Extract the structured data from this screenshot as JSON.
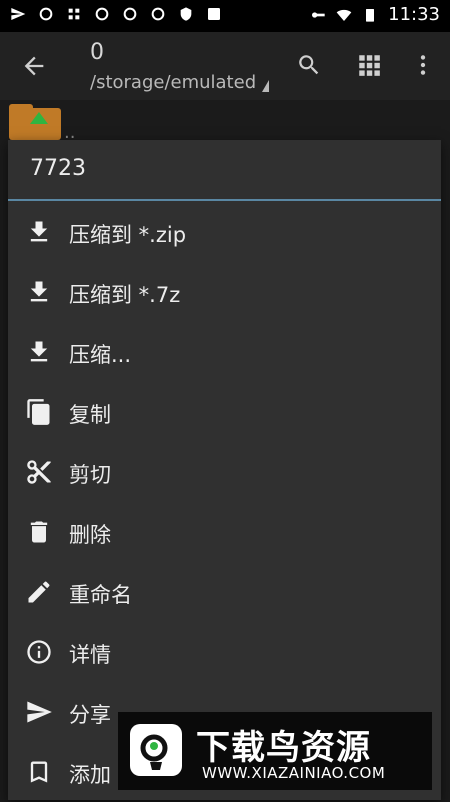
{
  "status_bar": {
    "time": "11:33"
  },
  "toolbar": {
    "title": "0",
    "path": "/storage/emulated"
  },
  "menu": {
    "title": "7723",
    "items": [
      {
        "label": "压缩到 *.zip",
        "icon": "download-icon"
      },
      {
        "label": "压缩到 *.7z",
        "icon": "download-icon"
      },
      {
        "label": "压缩...",
        "icon": "download-icon"
      },
      {
        "label": "复制",
        "icon": "copy-icon"
      },
      {
        "label": "剪切",
        "icon": "scissors-icon"
      },
      {
        "label": "删除",
        "icon": "trash-icon"
      },
      {
        "label": "重命名",
        "icon": "pencil-icon"
      },
      {
        "label": "详情",
        "icon": "info-icon"
      },
      {
        "label": "分享",
        "icon": "send-icon"
      },
      {
        "label": "添加",
        "icon": "bookmark-icon"
      }
    ]
  },
  "background": {
    "parent_label": ".."
  },
  "watermark": {
    "title": "下载鸟资源",
    "url": "WWW.XIAZAINIAO.COM"
  },
  "colors": {
    "accent_divider": "#5a87a3",
    "menu_bg": "#303030",
    "folder": "#c07a27"
  }
}
